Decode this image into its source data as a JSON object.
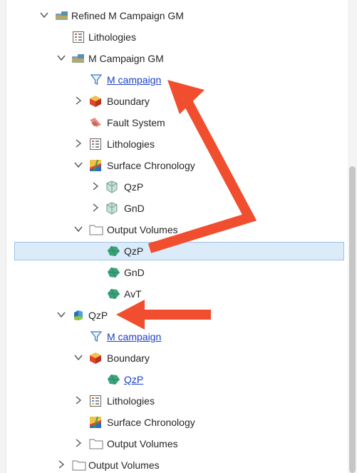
{
  "tree": {
    "refined_model": "Refined M Campaign GM",
    "lithologies_1": "Lithologies",
    "m_campaign_gm": "M Campaign GM",
    "m_campaign_link_1": "M campaign",
    "boundary_1": "Boundary",
    "fault_system": "Fault System",
    "lithologies_2": "Lithologies",
    "surface_chronology_1": "Surface Chronology",
    "surface_qzp": "QzP",
    "surface_gnd": "GnD",
    "output_volumes_1": "Output Volumes",
    "volume_qzp": "QzP",
    "volume_gnd": "GnD",
    "volume_avt": "AvT",
    "qzp_node": "QzP",
    "m_campaign_link_2": "M campaign",
    "boundary_2": "Boundary",
    "boundary_qzp_link": "QzP",
    "lithologies_3": "Lithologies",
    "surface_chronology_2": "Surface Chronology",
    "output_volumes_2": "Output Volumes",
    "output_volumes_3": "Output Volumes"
  },
  "icons": {
    "chevron_down": "chevron-down-icon",
    "chevron_right": "chevron-right-icon",
    "model_icon": "geological-model-icon",
    "lithology_list": "lithologies-list-icon",
    "filter": "funnel-filter-icon",
    "boundary": "boundary-cube-icon",
    "fault": "fault-system-icon",
    "chronology": "surface-chronology-icon",
    "surface": "surface-icon",
    "folder": "folder-icon",
    "volume": "volume-icon",
    "domain": "domain-model-icon"
  },
  "colors": {
    "selection_bg": "#dcebf9",
    "selection_border": "#9cc3ea",
    "link": "#1a3fc6",
    "annotation_arrow": "#f04e2f",
    "volume_green": "#3aa37a"
  }
}
